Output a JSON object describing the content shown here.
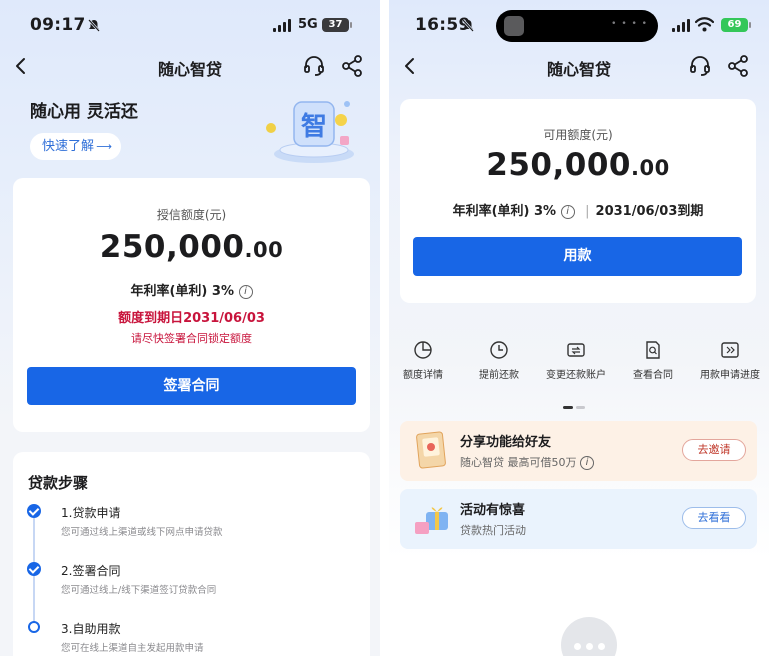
{
  "left": {
    "status": {
      "time": "09:17",
      "network": "5G",
      "battery": "37"
    },
    "nav": {
      "title": "随心智贷"
    },
    "hero": {
      "slogan": "随心用 灵活还",
      "quick_button": "快速了解",
      "badge_char": "智"
    },
    "credit_card": {
      "label": "授信额度(元)",
      "amount_int": "250,000",
      "amount_dec": ".00",
      "rate": "年利率(单利) 3%",
      "expire": "额度到期日2031/06/03",
      "notice": "请尽快签署合同锁定额度",
      "button": "签署合同"
    },
    "steps": {
      "title": "贷款步骤",
      "items": [
        {
          "name": "1.贷款申请",
          "desc": "您可通过线上渠道或线下网点申请贷款",
          "done": true
        },
        {
          "name": "2.签署合同",
          "desc": "您可通过线上/线下渠道签订贷款合同",
          "done": true
        },
        {
          "name": "3.自助用款",
          "desc": "您可在线上渠道自主发起用款申请",
          "done": false
        }
      ]
    }
  },
  "right": {
    "status": {
      "time": "16:59",
      "battery": "69"
    },
    "nav": {
      "title": "随心智贷"
    },
    "available_card": {
      "label": "可用额度(元)",
      "amount_int": "250,000",
      "amount_dec": ".00",
      "rate": "年利率(单利) 3%",
      "due": "2031/06/03到期",
      "button": "用款"
    },
    "features": [
      {
        "label": "额度详情",
        "icon": "pie-chart-icon"
      },
      {
        "label": "提前还款",
        "icon": "clock-icon"
      },
      {
        "label": "变更还款账户",
        "icon": "card-transfer-icon"
      },
      {
        "label": "查看合同",
        "icon": "document-search-icon"
      },
      {
        "label": "用款申请进度",
        "icon": "progress-icon"
      }
    ],
    "promos": [
      {
        "title": "分享功能给好友",
        "sub": "随心智贷 最高可借50万",
        "button": "去邀请",
        "accent": "#c0392b"
      },
      {
        "title": "活动有惊喜",
        "sub": "贷款热门活动",
        "button": "去看看",
        "accent": "#2f6fd8"
      }
    ]
  },
  "colors": {
    "primary": "#1866e6",
    "alert_red": "#c8143c",
    "invite_red": "#c0392b"
  }
}
